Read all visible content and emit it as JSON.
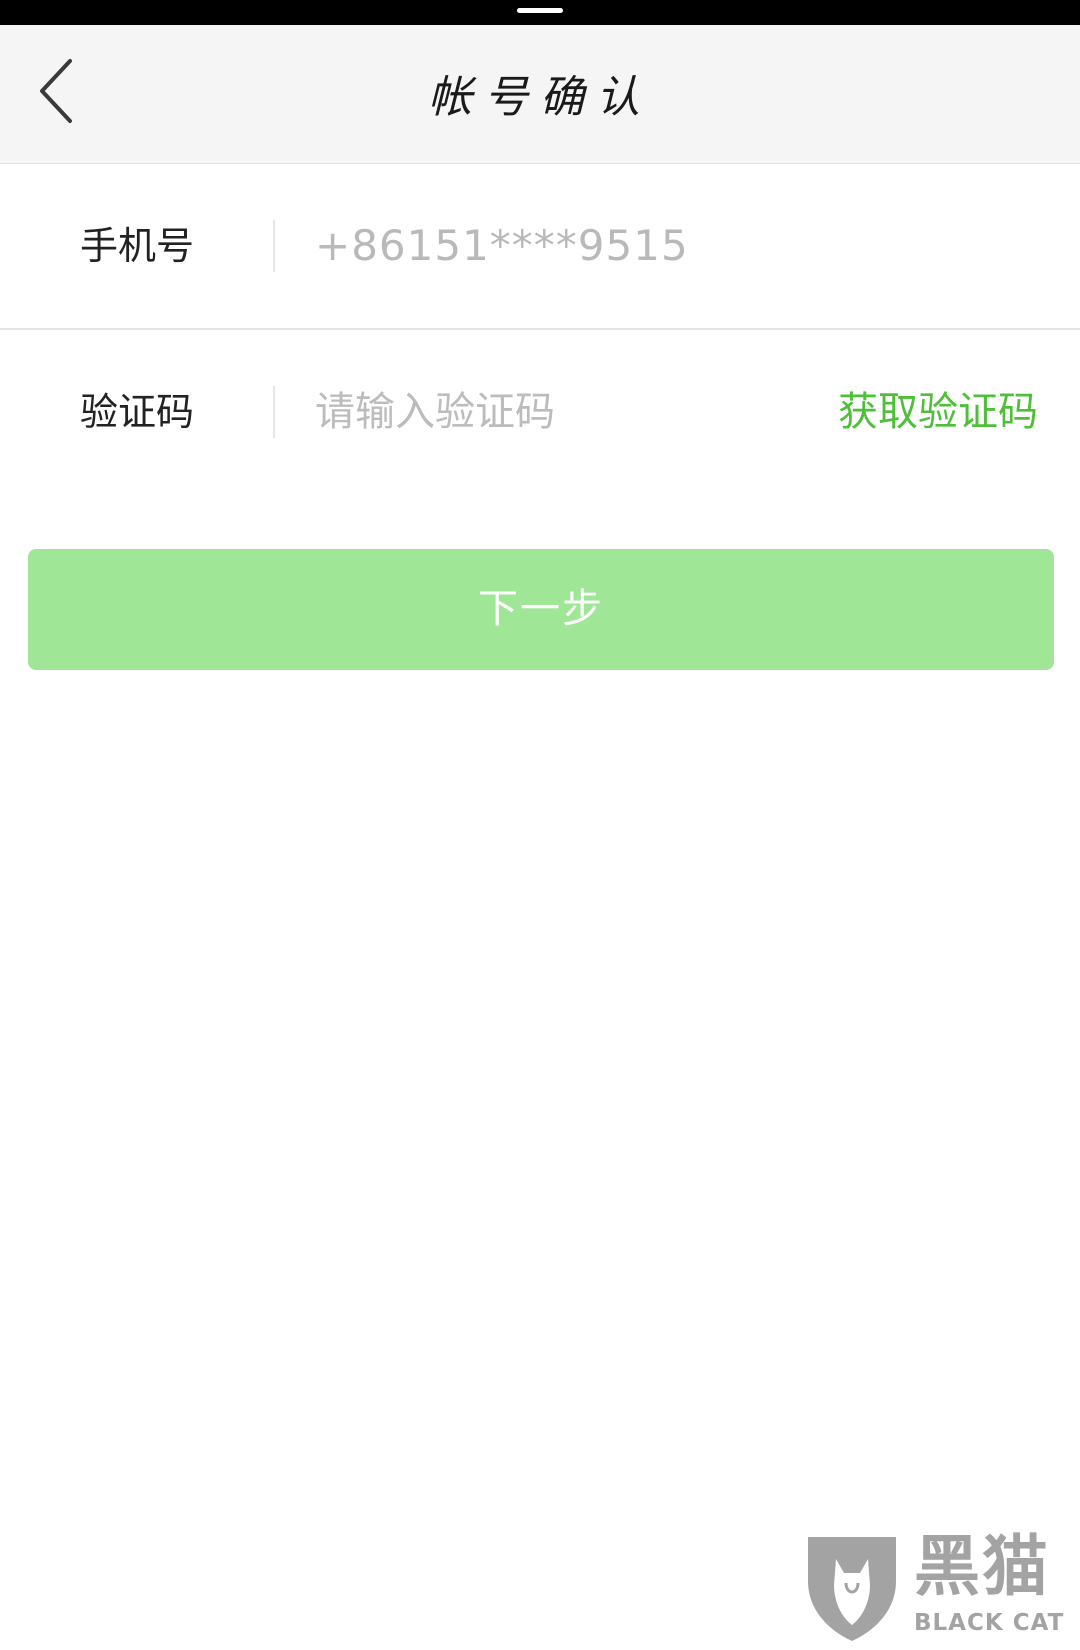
{
  "header": {
    "title": "帐号确认",
    "back_icon": "chevron-left-icon"
  },
  "form": {
    "phone": {
      "label": "手机号",
      "value": "+86151****9515"
    },
    "code": {
      "label": "验证码",
      "placeholder": "请输入验证码",
      "value": "",
      "get_code_label": "获取验证码"
    }
  },
  "next_button": {
    "label": "下一步"
  },
  "watermark": {
    "text_cn": "黑猫",
    "text_en": "BLACK CAT",
    "icon": "black-cat-shield-logo"
  },
  "colors": {
    "accent_green": "#4fbf3a",
    "button_disabled_green": "#9fe696",
    "navbar_bg": "#f5f5f5",
    "placeholder_gray": "#bcbcbc"
  }
}
